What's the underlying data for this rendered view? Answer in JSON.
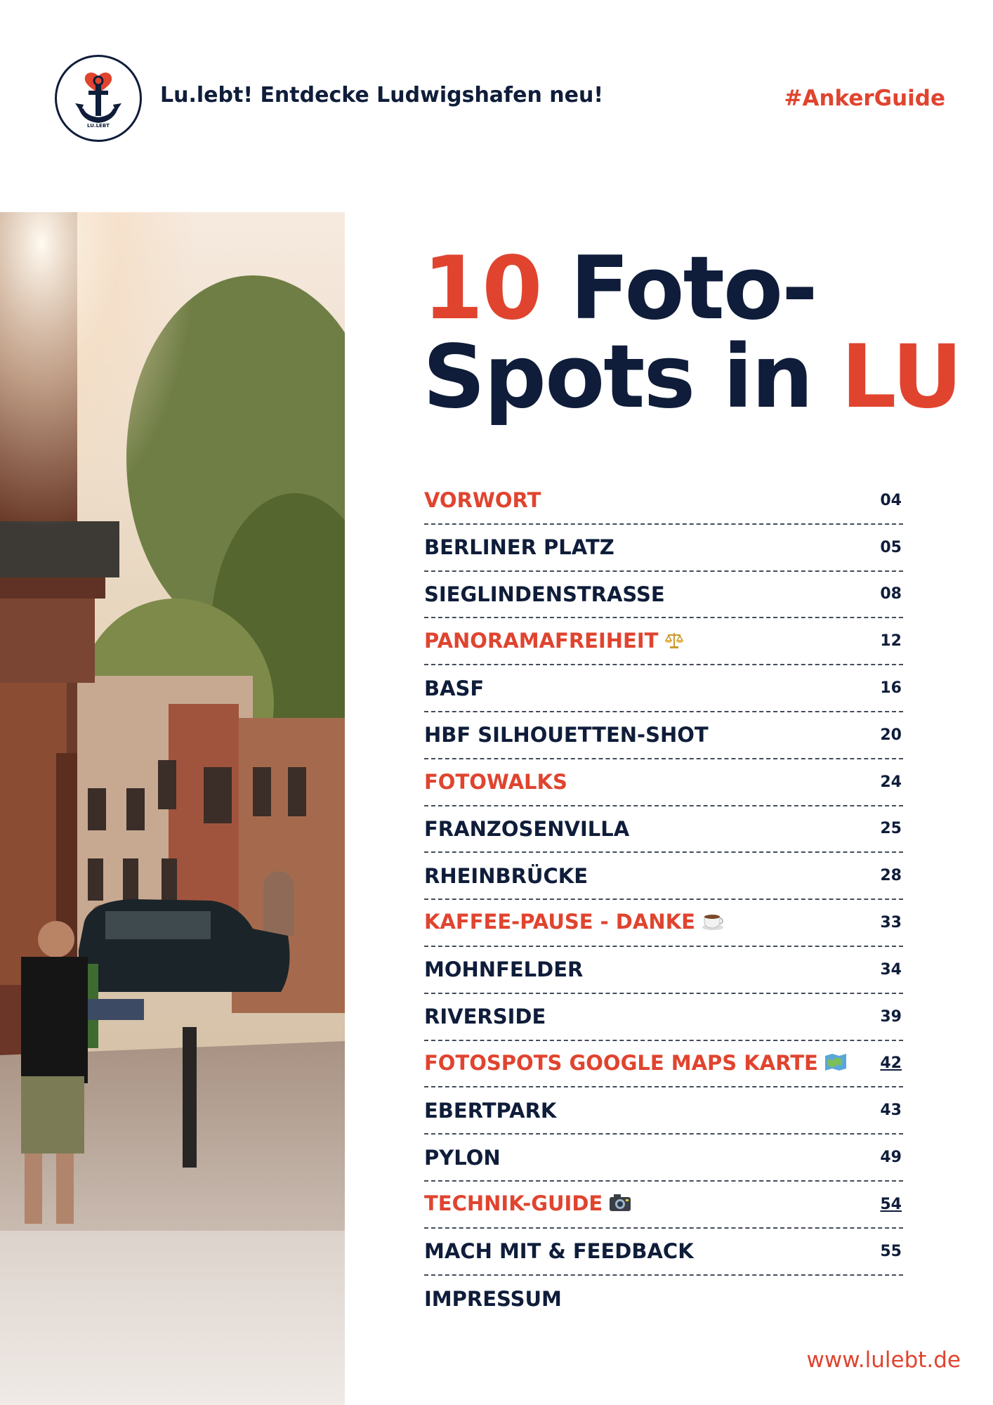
{
  "header": {
    "logo_text": "LU.LEBT",
    "tagline": "Lu.lebt! Entdecke Ludwigshafen neu!",
    "hashtag": "#AnkerGuide"
  },
  "title": {
    "number": "10",
    "line1_rest": " Foto-",
    "line2_main": "Spots in ",
    "line2_accent": "LU"
  },
  "toc": [
    {
      "label": "VORWORT",
      "page": "04",
      "highlight": true
    },
    {
      "label": "BERLINER PLATZ",
      "page": "05",
      "highlight": false
    },
    {
      "label": "SIEGLINDENSTRASSE",
      "page": "08",
      "highlight": false
    },
    {
      "label": "PANORAMAFREIHEIT",
      "page": "12",
      "highlight": true,
      "icon": "scales-icon"
    },
    {
      "label": "BASF",
      "page": "16",
      "highlight": false
    },
    {
      "label": "HBF SILHOUETTEN-SHOT",
      "page": "20",
      "highlight": false
    },
    {
      "label": "FOTOWALKS",
      "page": "24",
      "highlight": true
    },
    {
      "label": "FRANZOSENVILLA",
      "page": "25",
      "highlight": false
    },
    {
      "label": "RHEINBRÜCKE",
      "page": "28",
      "highlight": false
    },
    {
      "label": "KAFFEE-PAUSE - DANKE",
      "page": "33",
      "highlight": true,
      "icon": "coffee-icon"
    },
    {
      "label": "MOHNFELDER",
      "page": "34",
      "highlight": false
    },
    {
      "label": "RIVERSIDE",
      "page": "39",
      "highlight": false
    },
    {
      "label": "FOTOSPOTS GOOGLE MAPS KARTE",
      "page": "42",
      "highlight": true,
      "icon": "map-icon"
    },
    {
      "label": "EBERTPARK",
      "page": "43",
      "highlight": false
    },
    {
      "label": "PYLON",
      "page": "49",
      "highlight": false
    },
    {
      "label": "TECHNIK-GUIDE",
      "page": "54",
      "highlight": true,
      "icon": "camera-icon"
    },
    {
      "label": "MACH MIT & FEEDBACK",
      "page": "55",
      "highlight": false
    },
    {
      "label": "IMPRESSUM",
      "page": "",
      "highlight": false
    }
  ],
  "footer": {
    "url": "www.lulebt.de"
  },
  "colors": {
    "navy": "#0f1d3a",
    "accent": "#e0442f"
  }
}
